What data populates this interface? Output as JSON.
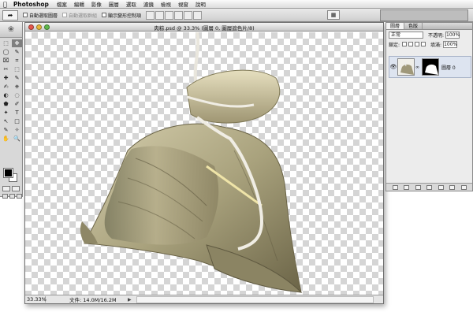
{
  "menubar": {
    "apple": "",
    "app": "Photoshop",
    "items": [
      "檔案",
      "編輯",
      "影像",
      "圖層",
      "選取",
      "濾鏡",
      "檢視",
      "視窗",
      "說明"
    ]
  },
  "options": {
    "auto_select_layer": "自動選取圖層",
    "auto_select_group": "自動選取群組",
    "show_transform": "顯示變形控制項"
  },
  "document": {
    "title": "肉粽.psd @ 33.3% (圖層 0, 圖層遮色片/8)",
    "zoom": "33.33%",
    "file_info": "文件: 14.0M/16.2M"
  },
  "layers_panel": {
    "tabs": [
      "圖層",
      "色版"
    ],
    "blend_mode": "正常",
    "opacity_label": "不透明:",
    "opacity": "100%",
    "lock_label": "鎖定:",
    "fill_label": "填滿:",
    "fill": "100%",
    "layer_name": "圖層 0",
    "eye": "👁"
  },
  "tools": {
    "items": [
      "⬚",
      "✥",
      "◯",
      "✎",
      "⌧",
      "⌗",
      "✂",
      "⬚",
      "✚",
      "✎",
      "✍",
      "⎈",
      "◐",
      "◌",
      "⬟",
      "✐",
      "✦",
      "T",
      "↖",
      "□",
      "✎",
      "✧",
      "✋",
      "🔍"
    ]
  },
  "colors": {
    "foreground": "#000000",
    "background": "#ffffff",
    "leaf_light": "#c8c0a0",
    "leaf_dark": "#6e6a4c"
  }
}
